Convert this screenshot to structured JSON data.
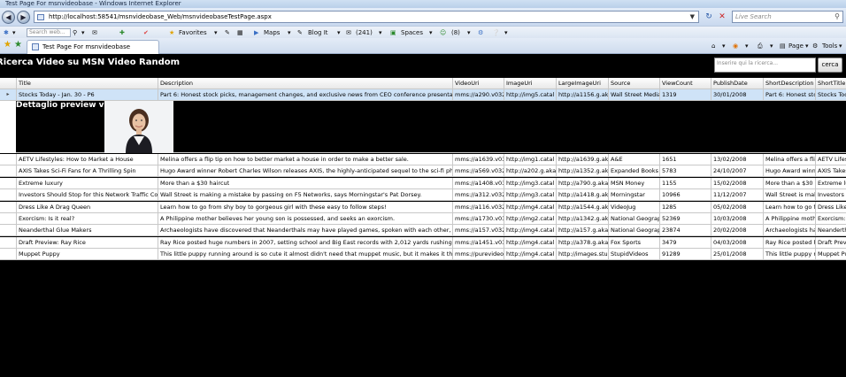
{
  "window": {
    "title": "Test Page For msnvideobase - Windows Internet Explorer"
  },
  "address": {
    "url": "http://localhost:58541/msnvideobase_Web/msnvideobaseTestPage.aspx"
  },
  "live_search": {
    "placeholder": "Live Search"
  },
  "toolbar": {
    "web_search_placeholder": "Search web...",
    "favorites": "Favorites",
    "maps": "Maps",
    "blog_it": "Blog It",
    "mail": "(241)",
    "spaces": "Spaces",
    "messenger": "(8)"
  },
  "tabs": {
    "active_label": "Test Page For msnvideobase",
    "page_menu": "Page",
    "tools_menu": "Tools"
  },
  "page": {
    "title": "Ricerca Video su MSN Video Random",
    "search_placeholder": "Inserire qui la ricerca...",
    "search_button": "cerca",
    "detail_label": "Dettaglio preview video:"
  },
  "grid": {
    "columns": [
      "Title",
      "Description",
      "VideoUri",
      "ImageUri",
      "LargeImageUri",
      "Source",
      "ViewCount",
      "PublishDate",
      "ShortDescription",
      "ShortTitle"
    ],
    "selected_row": [
      "Stocks Today - Jan. 30 - P6",
      "Part 6: Honest stock picks, management changes, and exclusive news from CEO conference presentations.",
      "mms://a290.v032",
      "http://img5.catal",
      "http://a1156.g.ak",
      "Wall Street Media",
      "1319",
      "30/01/2008",
      "Part 6: Honest sto",
      "Stocks Toda"
    ],
    "rows": [
      [
        "AETV Lifestyles: How to Market a House",
        "Melina offers a flip tip on how to better market a house in order to make a better sale.",
        "mms://a1639.v032",
        "http://img1.catal",
        "http://a1639.g.ak",
        "A&E",
        "1651",
        "13/02/2008",
        "Melina offers a flip",
        "AETV Lifes"
      ],
      [
        "AXIS Takes Sci-Fi Fans for A Thrilling Spin",
        "Hugo Award winner Robert Charles Wilson releases AXIS, the highly-anticipated sequel to the sci-fi phenomenon Sp",
        "mms://a569.v032",
        "http://a202.g.akai",
        "http://a1352.g.ak",
        "Expanded Books",
        "5783",
        "24/10/2007",
        "Hugo Award winne",
        "AXIS Takes"
      ],
      [
        "Extreme luxury",
        "More than a $30 haircut",
        "mms://a1408.v032",
        "http://img3.catal",
        "http://a790.g.akai",
        "MSN Money",
        "1155",
        "15/02/2008",
        "More than a $30 h",
        "Extreme lu"
      ],
      [
        "Investors Should Stop for this Network Traffic Cop",
        "Wall Street is making a mistake by passing on F5 Networks, says Morningstar's Pat Dorsey.",
        "mms://a312.v032",
        "http://img3.catal",
        "http://a1418.g.ak",
        "Morningstar",
        "10966",
        "11/12/2007",
        "Wall Street is maki",
        "Investors S"
      ],
      [
        "Dress Like A Drag Queen",
        "Learn how to go from shy boy to gorgeous girl with these easy to follow steps!",
        "mms://a116.v032",
        "http://img4.catal",
        "http://a1544.g.ak",
        "VideoJug",
        "1285",
        "05/02/2008",
        "Learn how to go fr",
        "Dress Like"
      ],
      [
        "Exorcism: Is it real?",
        "A Philippine mother believes her young son is possessed, and seeks an exorcism.",
        "mms://a1730.v032",
        "http://img2.catal",
        "http://a1342.g.ak",
        "National Geograph",
        "52369",
        "10/03/2008",
        "A Philippine mothe",
        "Exorcism:"
      ],
      [
        "Neanderthal Glue Makers",
        "Archaeologists have discovered that Neanderthals may have played games, spoken with each other, and made clot",
        "mms://a157.v032",
        "http://img4.catal",
        "http://a157.g.akai",
        "National Geograph",
        "23874",
        "20/02/2008",
        "Archaeologists hav",
        "Neanderthal"
      ],
      [
        "Draft Preview: Ray Rice",
        "Ray Rice posted huge numbers in 2007, setting school and Big East records with 2,012 yards rushing. Check out hig",
        "mms://a1451.v032",
        "http://img4.catal",
        "http://a378.g.akai",
        "Fox Sports",
        "3479",
        "04/03/2008",
        "Ray Rice posted hu",
        "Draft Previ"
      ],
      [
        "Muppet Puppy",
        "This little puppy running around is so cute it almost didn't need that muppet music, but it makes it that much bett",
        "mms://purevideo.",
        "http://img4.catal",
        "http://images.stup",
        "StupidVideos",
        "91289",
        "25/01/2008",
        "This little puppy ru",
        "Muppet Pup"
      ]
    ]
  }
}
